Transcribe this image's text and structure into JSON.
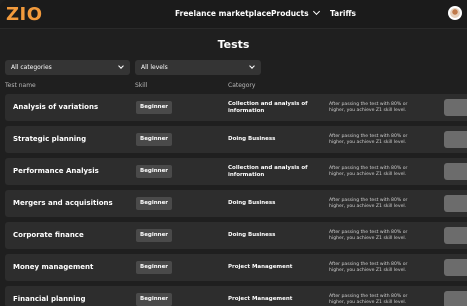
{
  "header": {
    "logo": "ZIO",
    "nav": {
      "marketplace": "Freelance marketplace",
      "products": "Products",
      "tariffs": "Tariffs"
    }
  },
  "page": {
    "title": "Tests"
  },
  "filters": {
    "categories": "All categories",
    "levels": "All levels"
  },
  "columns": {
    "name": "Test name",
    "skill": "Skill",
    "category": "Category"
  },
  "tests": [
    {
      "name": "Analysis of variations",
      "skill": "Beginner",
      "category": "Collection and analysis of information",
      "note": "After passing the test with 80% or higher, you achieve Z1 skill level."
    },
    {
      "name": "Strategic planning",
      "skill": "Beginner",
      "category": "Doing Business",
      "note": "After passing the test with 80% or higher, you achieve Z1 skill level."
    },
    {
      "name": "Performance Analysis",
      "skill": "Beginner",
      "category": "Collection and analysis of information",
      "note": "After passing the test with 80% or higher, you achieve Z1 skill level."
    },
    {
      "name": "Mergers and acquisitions",
      "skill": "Beginner",
      "category": "Doing Business",
      "note": "After passing the test with 80% or higher, you achieve Z1 skill level."
    },
    {
      "name": "Corporate finance",
      "skill": "Beginner",
      "category": "Doing Business",
      "note": "After passing the test with 80% or higher, you achieve Z1 skill level."
    },
    {
      "name": "Money management",
      "skill": "Beginner",
      "category": "Project Management",
      "note": "After passing the test with 80% or higher, you achieve Z1 skill level."
    },
    {
      "name": "Financial planning",
      "skill": "Beginner",
      "category": "Project Management",
      "note": "After passing the test with 80% or higher, you achieve Z1 skill level."
    }
  ]
}
